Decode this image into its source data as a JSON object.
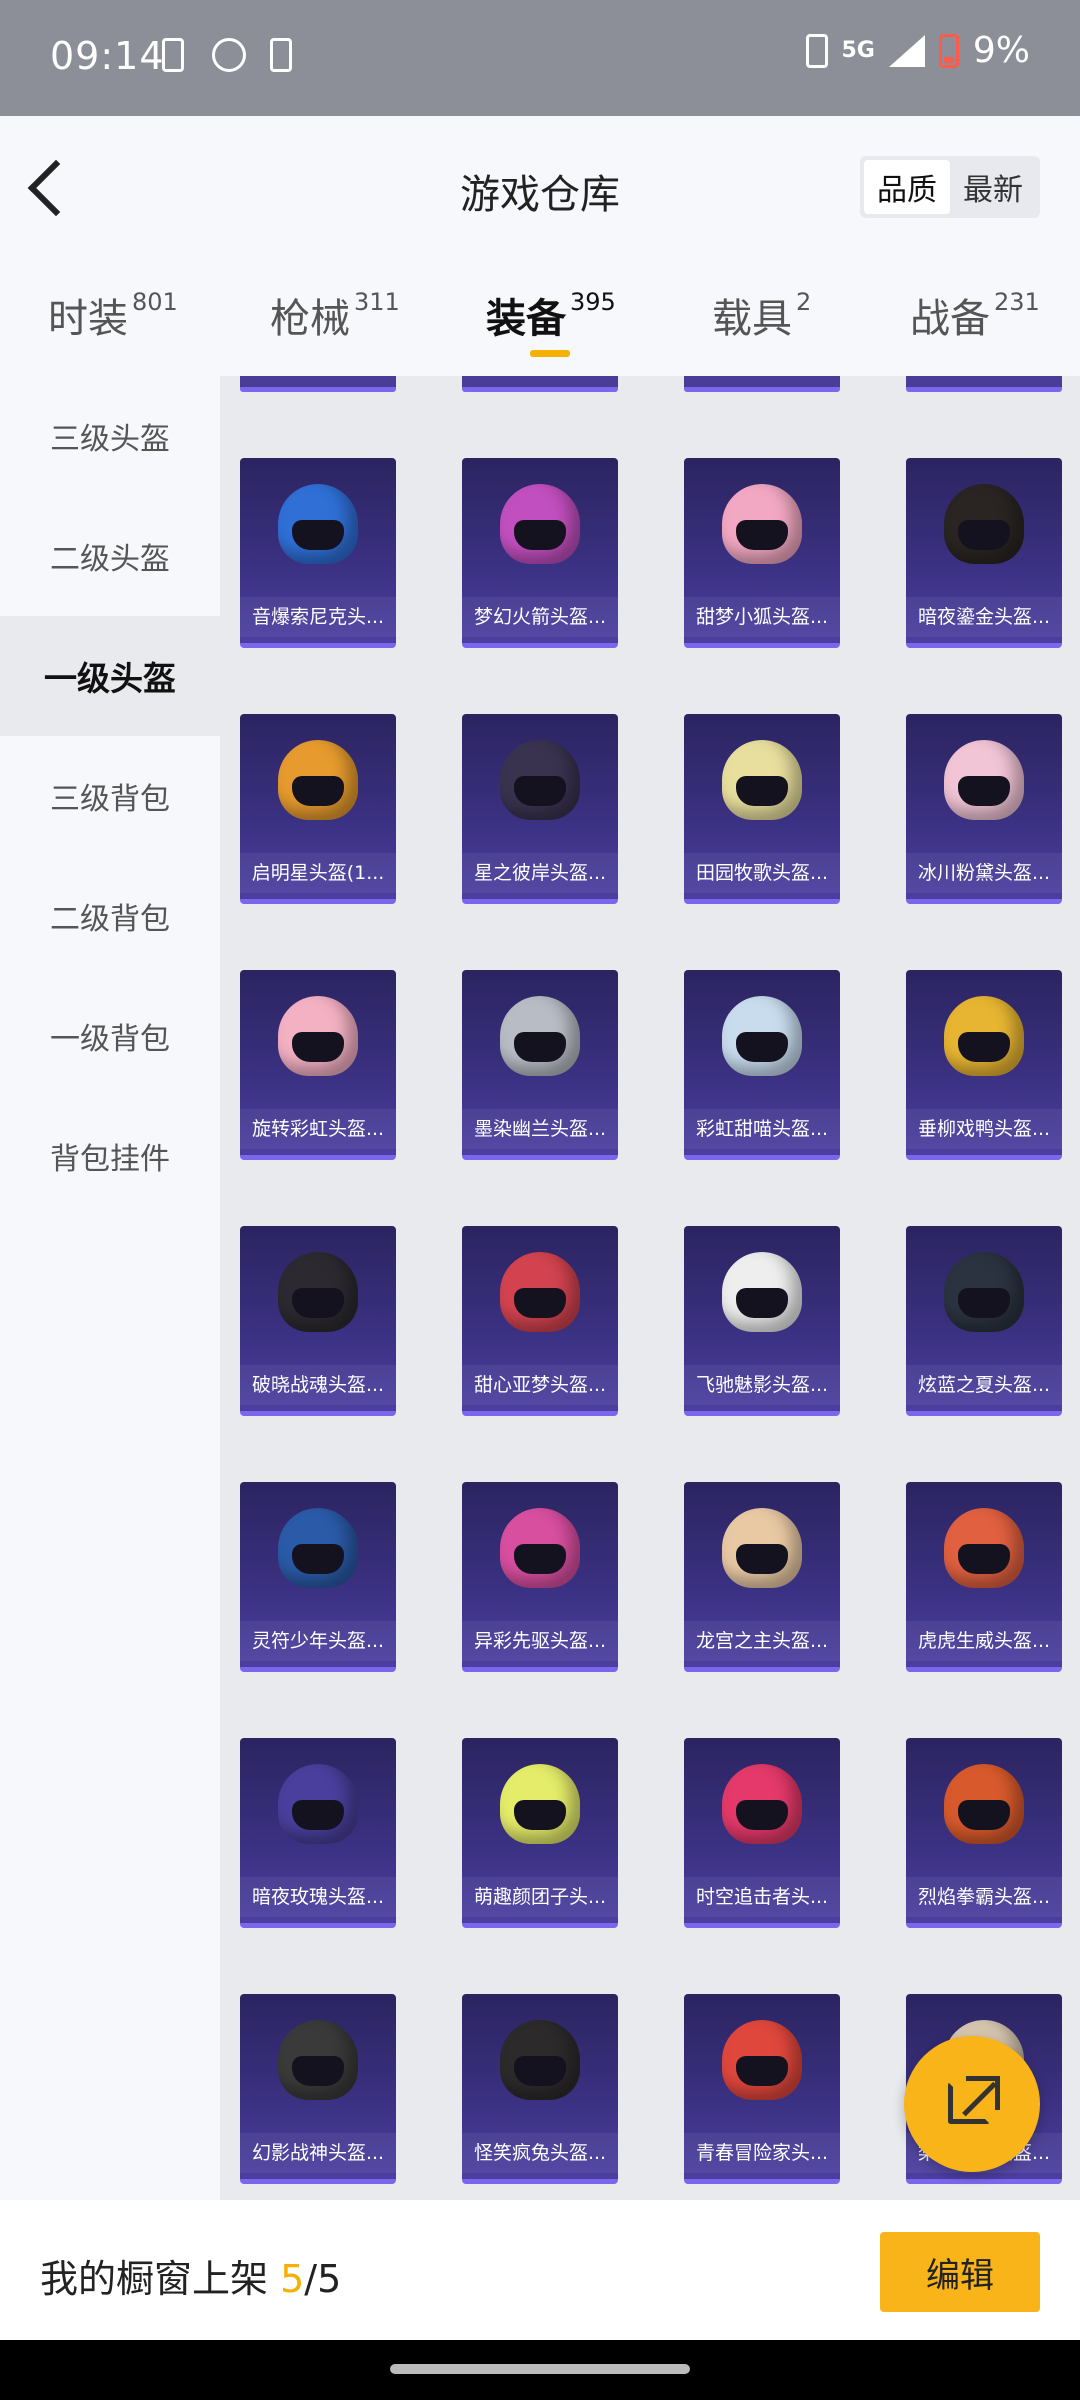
{
  "status": {
    "time": "09:14",
    "network": "5G",
    "battery": "9%"
  },
  "header": {
    "title": "游戏仓库",
    "sort_options": [
      "品质",
      "最新"
    ],
    "sort_active": "品质"
  },
  "tabs": [
    {
      "label": "时装",
      "count": "801"
    },
    {
      "label": "枪械",
      "count": "311"
    },
    {
      "label": "装备",
      "count": "395"
    },
    {
      "label": "载具",
      "count": "2"
    },
    {
      "label": "战备",
      "count": "231"
    }
  ],
  "active_tab": "装备",
  "sidebar": [
    {
      "label": "三级头盔"
    },
    {
      "label": "二级头盔"
    },
    {
      "label": "一级头盔"
    },
    {
      "label": "三级背包"
    },
    {
      "label": "二级背包"
    },
    {
      "label": "一级背包"
    },
    {
      "label": "背包挂件"
    }
  ],
  "active_category": "一级头盔",
  "items": [
    {
      "name": "音爆索尼克头...",
      "color": "#2f6fd6"
    },
    {
      "name": "梦幻火箭头盔...",
      "color": "#c24fbf"
    },
    {
      "name": "甜梦小狐头盔...",
      "color": "#f2a8c2"
    },
    {
      "name": "暗夜鎏金头盔...",
      "color": "#2a2522"
    },
    {
      "name": "启明星头盔(1...",
      "color": "#e79b2e"
    },
    {
      "name": "星之彼岸头盔...",
      "color": "#3a3350"
    },
    {
      "name": "田园牧歌头盔...",
      "color": "#e8df9e"
    },
    {
      "name": "冰川粉黛头盔...",
      "color": "#f1c4d6"
    },
    {
      "name": "旋转彩虹头盔...",
      "color": "#f4b1c4"
    },
    {
      "name": "墨染幽兰头盔...",
      "color": "#b8bcc4"
    },
    {
      "name": "彩虹甜喵头盔...",
      "color": "#c8dcee"
    },
    {
      "name": "垂柳戏鸭头盔...",
      "color": "#e7b532"
    },
    {
      "name": "破晓战魂头盔...",
      "color": "#2c2a30"
    },
    {
      "name": "甜心亚梦头盔...",
      "color": "#d2434f"
    },
    {
      "name": "飞驰魅影头盔...",
      "color": "#eeeeee"
    },
    {
      "name": "炫蓝之夏头盔...",
      "color": "#2b3340"
    },
    {
      "name": "灵符少年头盔...",
      "color": "#2b5aa8"
    },
    {
      "name": "异彩先驱头盔...",
      "color": "#d84fa0"
    },
    {
      "name": "龙宫之主头盔...",
      "color": "#e9c9a4"
    },
    {
      "name": "虎虎生威头盔...",
      "color": "#e06040"
    },
    {
      "name": "暗夜玫瑰头盔...",
      "color": "#4a3f9c"
    },
    {
      "name": "萌趣颜团子头...",
      "color": "#e4ec6a"
    },
    {
      "name": "时空追击者头...",
      "color": "#e4396a"
    },
    {
      "name": "烈焰拳霸头盔...",
      "color": "#d85a2c"
    },
    {
      "name": "幻影战神头盔...",
      "color": "#3a3a3a"
    },
    {
      "name": "怪笑疯兔头盔...",
      "color": "#2d2a2c"
    },
    {
      "name": "青春冒险家头...",
      "color": "#e0473c"
    },
    {
      "name": "梨园星光头盔...",
      "color": "#d6c6b0"
    }
  ],
  "footer": {
    "label": "我的橱窗上架 ",
    "shown": "5",
    "total": "/5",
    "edit_label": "编辑"
  }
}
